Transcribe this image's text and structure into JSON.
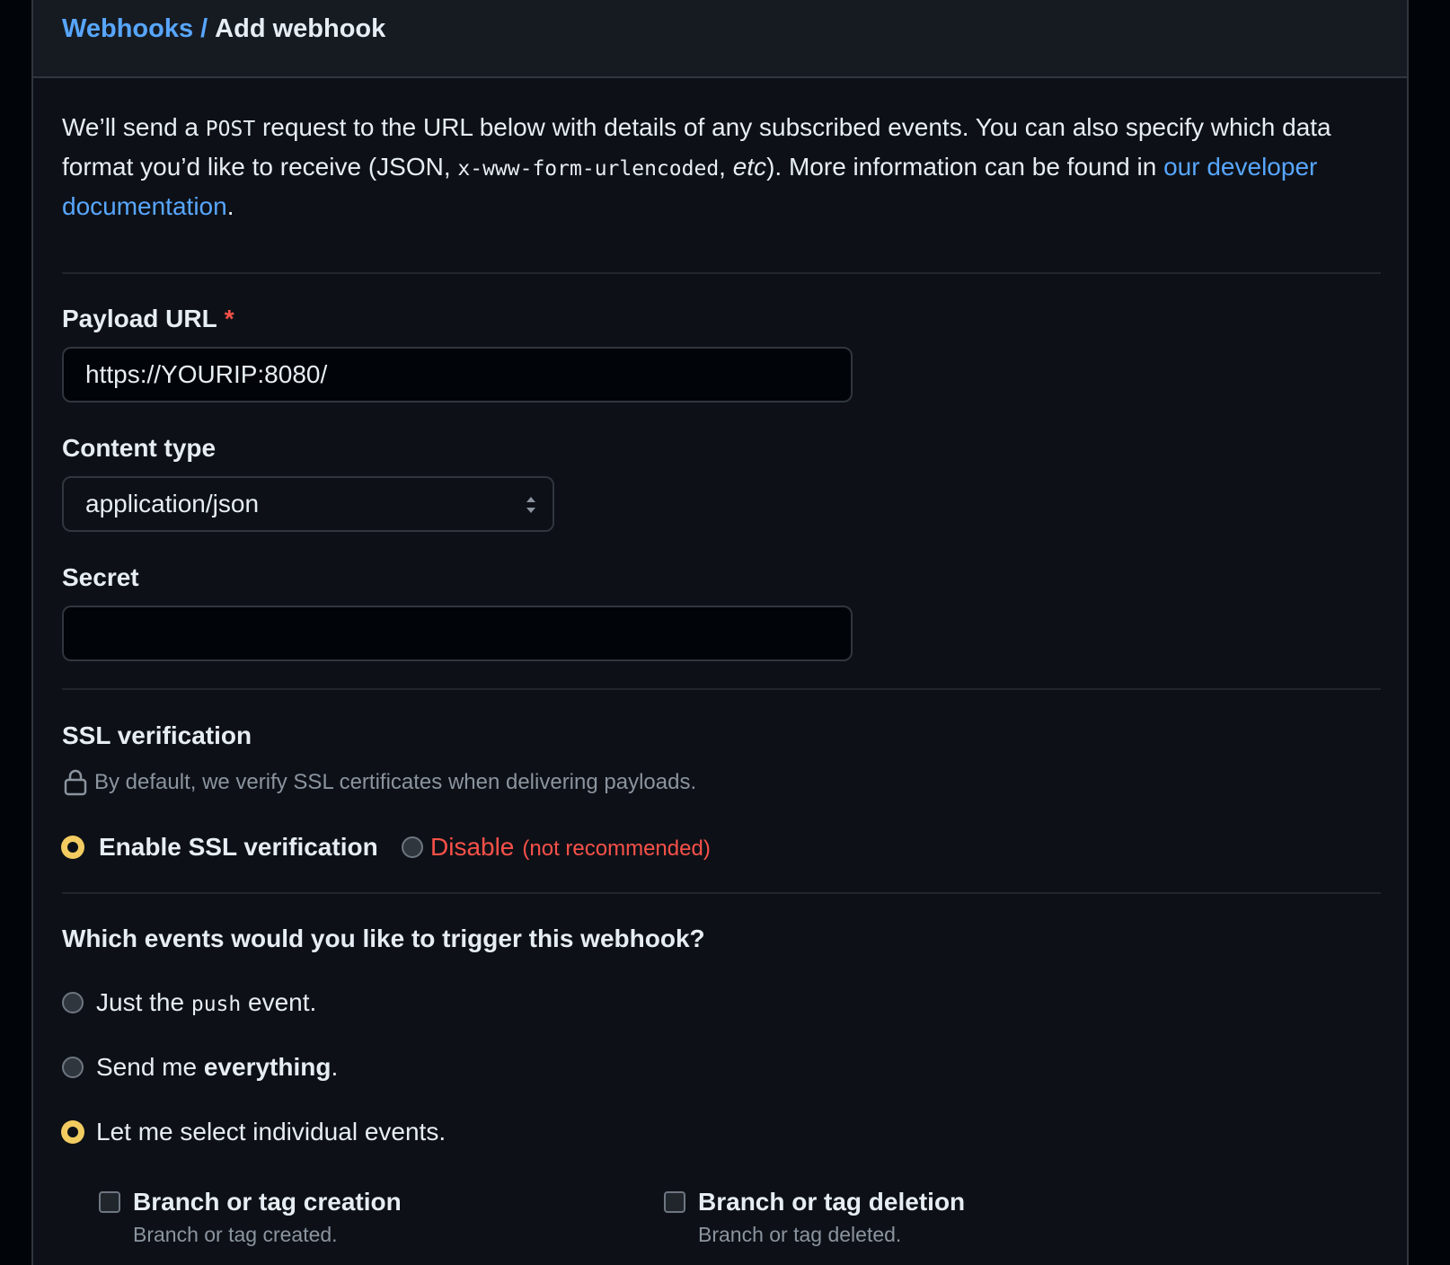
{
  "breadcrumb": {
    "parent": "Webhooks",
    "separator": "/",
    "current": "Add webhook"
  },
  "intro": {
    "part1": "We’ll send a ",
    "code1": "POST",
    "part2": " request to the URL below with details of any subscribed events. You can also specify which data format you’d like to receive (JSON, ",
    "code2": "x-www-form-urlencoded",
    "part3": ", ",
    "etc": "etc",
    "part4": "). More information can be found in ",
    "link": "our developer documentation",
    "end": "."
  },
  "payload_url": {
    "label": "Payload URL",
    "required_mark": "*",
    "value": "https://YOURIP:8080/"
  },
  "content_type": {
    "label": "Content type",
    "selected": "application/json"
  },
  "secret": {
    "label": "Secret",
    "value": ""
  },
  "ssl": {
    "heading": "SSL verification",
    "note": "By default, we verify SSL certificates when delivering payloads.",
    "enable_label": "Enable SSL verification",
    "disable_label": "Disable",
    "disable_note": "(not recommended)",
    "selected": "enable"
  },
  "events": {
    "heading": "Which events would you like to trigger this webhook?",
    "option1_pre": "Just the ",
    "option1_code": "push",
    "option1_post": " event.",
    "option2_pre": "Send me ",
    "option2_bold": "everything",
    "option2_post": ".",
    "option3": "Let me select individual events.",
    "selected": "individual"
  },
  "individual_events": [
    {
      "title": "Branch or tag creation",
      "description": "Branch or tag created.",
      "checked": false
    },
    {
      "title": "Branch or tag deletion",
      "description": "Branch or tag deleted.",
      "checked": false
    }
  ],
  "colors": {
    "link": "#58a6ff",
    "danger": "#f85149",
    "radio_selected": "#f2cc60",
    "background": "#0d1117"
  }
}
